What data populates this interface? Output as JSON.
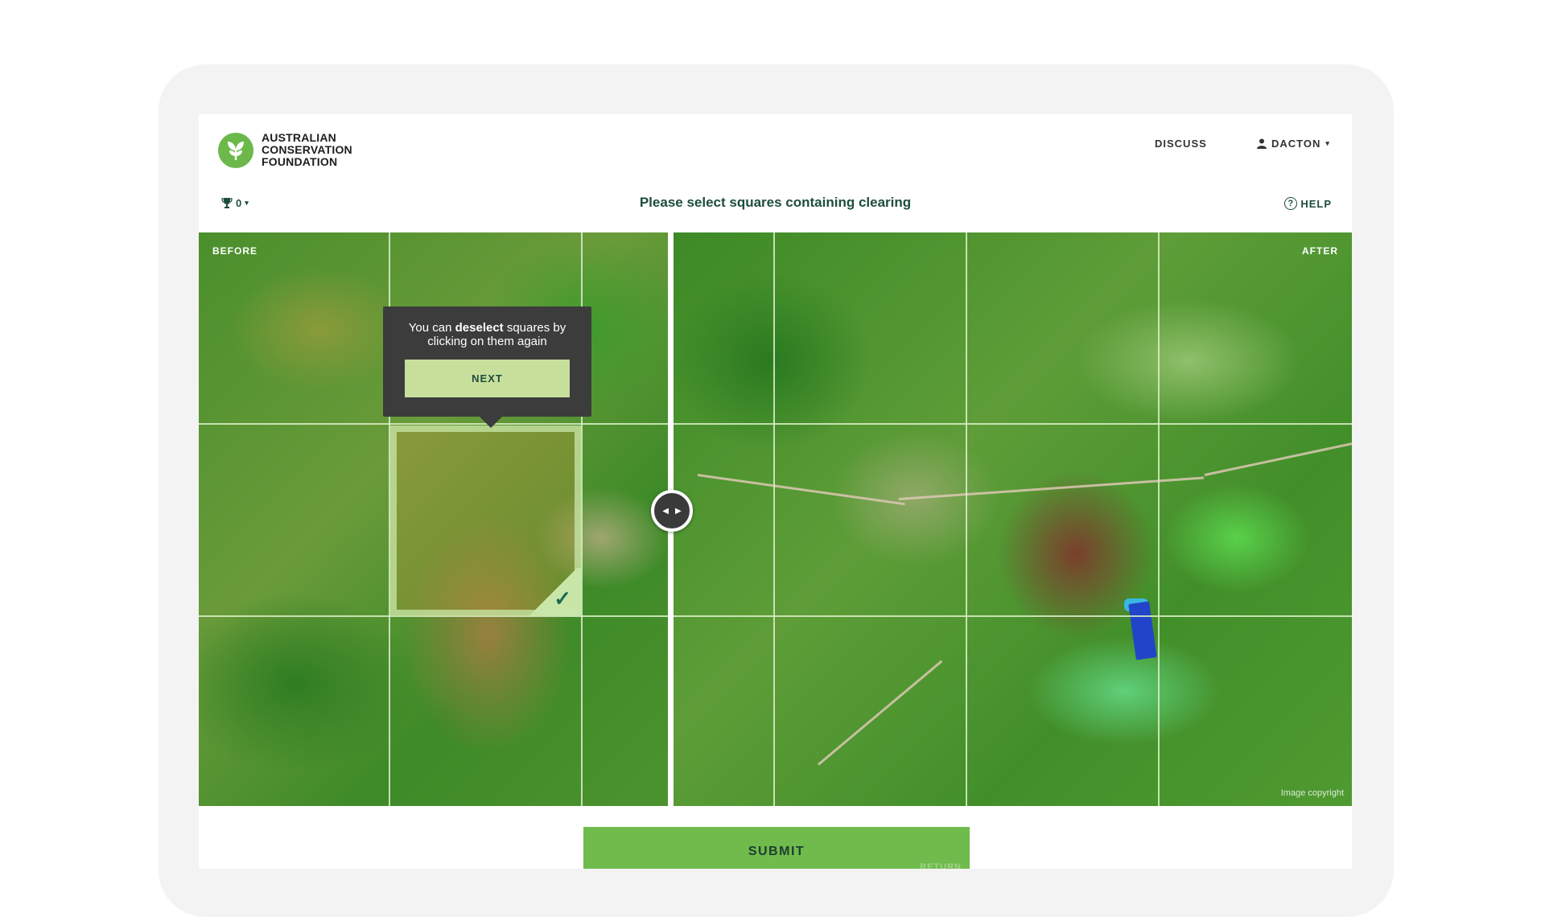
{
  "logo": {
    "lines": [
      "AUSTRALIAN",
      "CONSERVATION",
      "FOUNDATION"
    ],
    "icon": "leaf-icon",
    "color": "#6cb84a"
  },
  "nav": {
    "discuss": "DISCUSS",
    "user": "DACTON"
  },
  "score": {
    "value": "0",
    "icon": "trophy-icon"
  },
  "prompt": "Please select squares containing clearing",
  "help": {
    "label": "HELP",
    "glyph": "?"
  },
  "imagery": {
    "before_label": "BEFORE",
    "after_label": "AFTER",
    "copyright": "Image copyright",
    "grid_columns": 7,
    "grid_rows": 3,
    "selected_cells": [
      {
        "row": 2,
        "col": 2
      }
    ]
  },
  "tooltip": {
    "text_before": "You can",
    "text_bold": "deselect",
    "text_after": "squares by clicking on them again",
    "button": "NEXT"
  },
  "submit": {
    "label": "SUBMIT",
    "hint": "RETURN"
  },
  "colors": {
    "accent": "#6fbb4c",
    "text_dark": "#1e4d3b",
    "tooltip_bg": "#3c3c3c",
    "next_bg": "#c8df9c"
  }
}
